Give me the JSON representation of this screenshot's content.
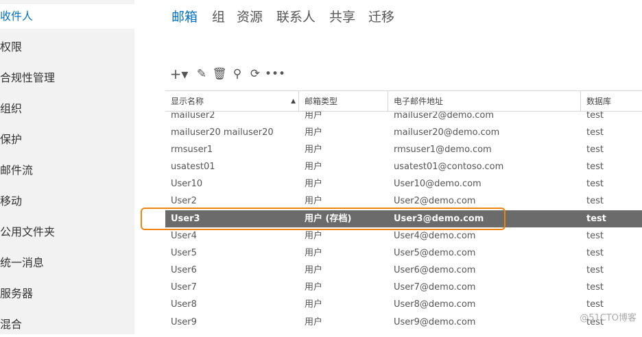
{
  "sidebar": {
    "items": [
      {
        "label": "收件人",
        "active": true
      },
      {
        "label": "权限",
        "active": false
      },
      {
        "label": "合规性管理",
        "active": false
      },
      {
        "label": "组织",
        "active": false
      },
      {
        "label": "保护",
        "active": false
      },
      {
        "label": "邮件流",
        "active": false
      },
      {
        "label": "移动",
        "active": false
      },
      {
        "label": "公用文件夹",
        "active": false
      },
      {
        "label": "统一消息",
        "active": false
      },
      {
        "label": "服务器",
        "active": false
      },
      {
        "label": "混合",
        "active": false
      }
    ]
  },
  "tabs": [
    {
      "label": "邮箱",
      "active": true
    },
    {
      "label": "组",
      "active": false
    },
    {
      "label": "资源",
      "active": false
    },
    {
      "label": "联系人",
      "active": false
    },
    {
      "label": "共享",
      "active": false
    },
    {
      "label": "迁移",
      "active": false
    }
  ],
  "toolbar": {
    "icons": [
      "add-icon",
      "edit-icon",
      "delete-icon",
      "search-icon",
      "refresh-icon",
      "more-icon"
    ],
    "glyphs": [
      "+▾",
      "✎",
      "🗑",
      "⚲",
      "⟳",
      "•••"
    ]
  },
  "grid": {
    "columns": [
      "显示名称",
      "邮箱类型",
      "电子邮件地址",
      "数据库"
    ],
    "sort_indicator": "▲",
    "rows": [
      [
        "mailuser2",
        "用户",
        "mailuser2@demo.com",
        "test"
      ],
      [
        "mailuser20 mailuser20",
        "用户",
        "mailuser20@demo.com",
        "test"
      ],
      [
        "rmsuser1",
        "用户",
        "rmsuser1@demo.com",
        "test"
      ],
      [
        "usatest01",
        "用户",
        "usatest01@contoso.com",
        "test"
      ],
      [
        "User10",
        "用户",
        "User10@demo.com",
        "test"
      ],
      [
        "User2",
        "用户",
        "User2@demo.com",
        "test"
      ],
      [
        "User3",
        "用户 (存档)",
        "User3@demo.com",
        "test"
      ],
      [
        "User4",
        "用户",
        "User4@demo.com",
        "test"
      ],
      [
        "User5",
        "用户",
        "User5@demo.com",
        "test"
      ],
      [
        "User6",
        "用户",
        "User6@demo.com",
        "test"
      ],
      [
        "User7",
        "用户",
        "User7@demo.com",
        "test"
      ],
      [
        "User8",
        "用户",
        "User8@demo.com",
        "test"
      ],
      [
        "User9",
        "用户",
        "User9@demo.com",
        "test"
      ]
    ],
    "selected_row": "User3"
  },
  "watermark": "@51CTO博客",
  "colors": {
    "accent": "#0072c6",
    "selected_row": "#6b6b6b",
    "highlight_border": "#f0830f"
  }
}
